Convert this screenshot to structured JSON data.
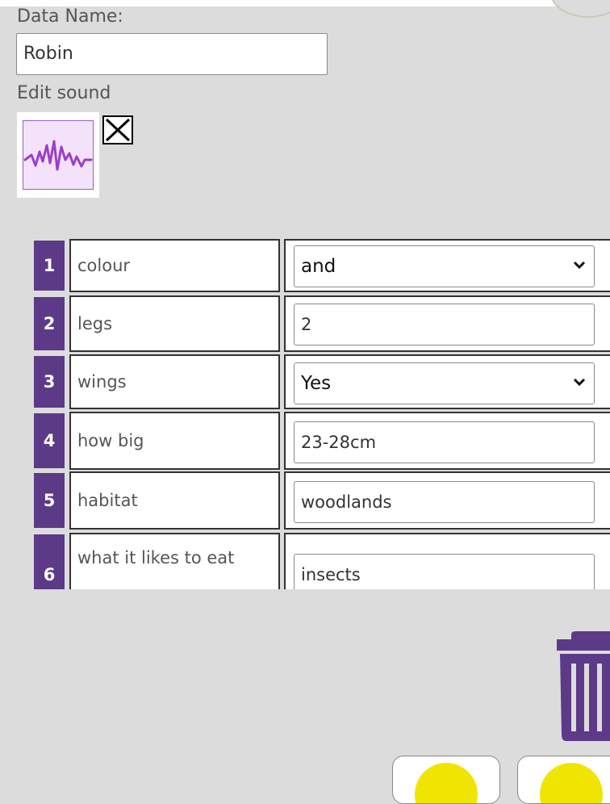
{
  "form": {
    "data_name_label": "Data Name:",
    "data_name_value": "Robin",
    "edit_sound_label": "Edit sound"
  },
  "icons": {
    "sound": "waveform-icon",
    "remove": "close-x-icon",
    "dropdown": "chevron-down-icon",
    "delete": "trash-can-icon"
  },
  "colors": {
    "accent_purple": "#5d3a88",
    "sound_tile_bg": "#f4e2fb",
    "waveform": "#9b3fc9",
    "nav_ball": "#f0e500",
    "background": "#dcdcdc"
  },
  "rows": [
    {
      "number": "1",
      "label": "colour",
      "type": "select",
      "value": "and"
    },
    {
      "number": "2",
      "label": "legs",
      "type": "text",
      "value": "2"
    },
    {
      "number": "3",
      "label": "wings",
      "type": "select",
      "value": "Yes"
    },
    {
      "number": "4",
      "label": "how big",
      "type": "text",
      "value": "23-28cm"
    },
    {
      "number": "5",
      "label": "habitat",
      "type": "text",
      "value": "woodlands"
    },
    {
      "number": "6",
      "label": "what it likes to eat",
      "type": "text",
      "value": "insects"
    }
  ]
}
